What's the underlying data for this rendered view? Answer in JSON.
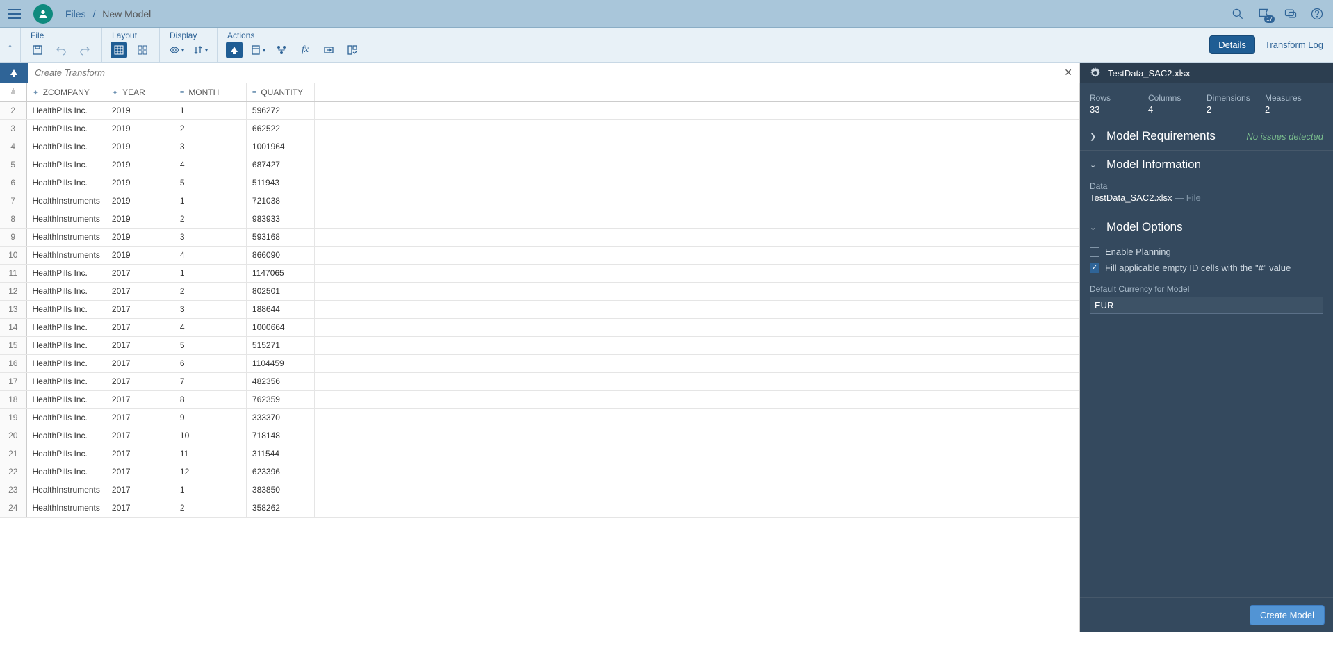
{
  "breadcrumb": {
    "root": "Files",
    "current": "New Model"
  },
  "topbar": {
    "notif_count": "17"
  },
  "ribbon": {
    "file_label": "File",
    "layout_label": "Layout",
    "display_label": "Display",
    "actions_label": "Actions",
    "details_btn": "Details",
    "transform_log": "Transform Log"
  },
  "transform": {
    "placeholder": "Create Transform"
  },
  "table": {
    "columns": [
      "ZCOMPANY",
      "YEAR",
      "MONTH",
      "QUANTITY"
    ],
    "rows": [
      {
        "n": "2",
        "c": [
          "HealthPills Inc.",
          "2019",
          "1",
          "596272"
        ]
      },
      {
        "n": "3",
        "c": [
          "HealthPills Inc.",
          "2019",
          "2",
          "662522"
        ]
      },
      {
        "n": "4",
        "c": [
          "HealthPills Inc.",
          "2019",
          "3",
          "1001964"
        ]
      },
      {
        "n": "5",
        "c": [
          "HealthPills Inc.",
          "2019",
          "4",
          "687427"
        ]
      },
      {
        "n": "6",
        "c": [
          "HealthPills Inc.",
          "2019",
          "5",
          "511943"
        ]
      },
      {
        "n": "7",
        "c": [
          "HealthInstruments",
          "2019",
          "1",
          "721038"
        ]
      },
      {
        "n": "8",
        "c": [
          "HealthInstruments",
          "2019",
          "2",
          "983933"
        ]
      },
      {
        "n": "9",
        "c": [
          "HealthInstruments",
          "2019",
          "3",
          "593168"
        ]
      },
      {
        "n": "10",
        "c": [
          "HealthInstruments",
          "2019",
          "4",
          "866090"
        ]
      },
      {
        "n": "11",
        "c": [
          "HealthPills Inc.",
          "2017",
          "1",
          "1147065"
        ]
      },
      {
        "n": "12",
        "c": [
          "HealthPills Inc.",
          "2017",
          "2",
          "802501"
        ]
      },
      {
        "n": "13",
        "c": [
          "HealthPills Inc.",
          "2017",
          "3",
          "188644"
        ]
      },
      {
        "n": "14",
        "c": [
          "HealthPills Inc.",
          "2017",
          "4",
          "1000664"
        ]
      },
      {
        "n": "15",
        "c": [
          "HealthPills Inc.",
          "2017",
          "5",
          "515271"
        ]
      },
      {
        "n": "16",
        "c": [
          "HealthPills Inc.",
          "2017",
          "6",
          "1104459"
        ]
      },
      {
        "n": "17",
        "c": [
          "HealthPills Inc.",
          "2017",
          "7",
          "482356"
        ]
      },
      {
        "n": "18",
        "c": [
          "HealthPills Inc.",
          "2017",
          "8",
          "762359"
        ]
      },
      {
        "n": "19",
        "c": [
          "HealthPills Inc.",
          "2017",
          "9",
          "333370"
        ]
      },
      {
        "n": "20",
        "c": [
          "HealthPills Inc.",
          "2017",
          "10",
          "718148"
        ]
      },
      {
        "n": "21",
        "c": [
          "HealthPills Inc.",
          "2017",
          "11",
          "311544"
        ]
      },
      {
        "n": "22",
        "c": [
          "HealthPills Inc.",
          "2017",
          "12",
          "623396"
        ]
      },
      {
        "n": "23",
        "c": [
          "HealthInstruments",
          "2017",
          "1",
          "383850"
        ]
      },
      {
        "n": "24",
        "c": [
          "HealthInstruments",
          "2017",
          "2",
          "358262"
        ]
      }
    ]
  },
  "panel": {
    "filename": "TestData_SAC2.xlsx",
    "stats": {
      "rows_label": "Rows",
      "rows_value": "33",
      "cols_label": "Columns",
      "cols_value": "4",
      "dims_label": "Dimensions",
      "dims_value": "2",
      "meas_label": "Measures",
      "meas_value": "2"
    },
    "requirements": {
      "title": "Model Requirements",
      "status": "No issues detected"
    },
    "information": {
      "title": "Model Information",
      "data_label": "Data",
      "data_value": "TestData_SAC2.xlsx",
      "data_type": "— File"
    },
    "options": {
      "title": "Model Options",
      "enable_planning": "Enable Planning",
      "fill_empty": "Fill applicable empty ID cells with the \"#\" value",
      "currency_label": "Default Currency for Model",
      "currency_value": "EUR"
    },
    "create_button": "Create Model"
  }
}
